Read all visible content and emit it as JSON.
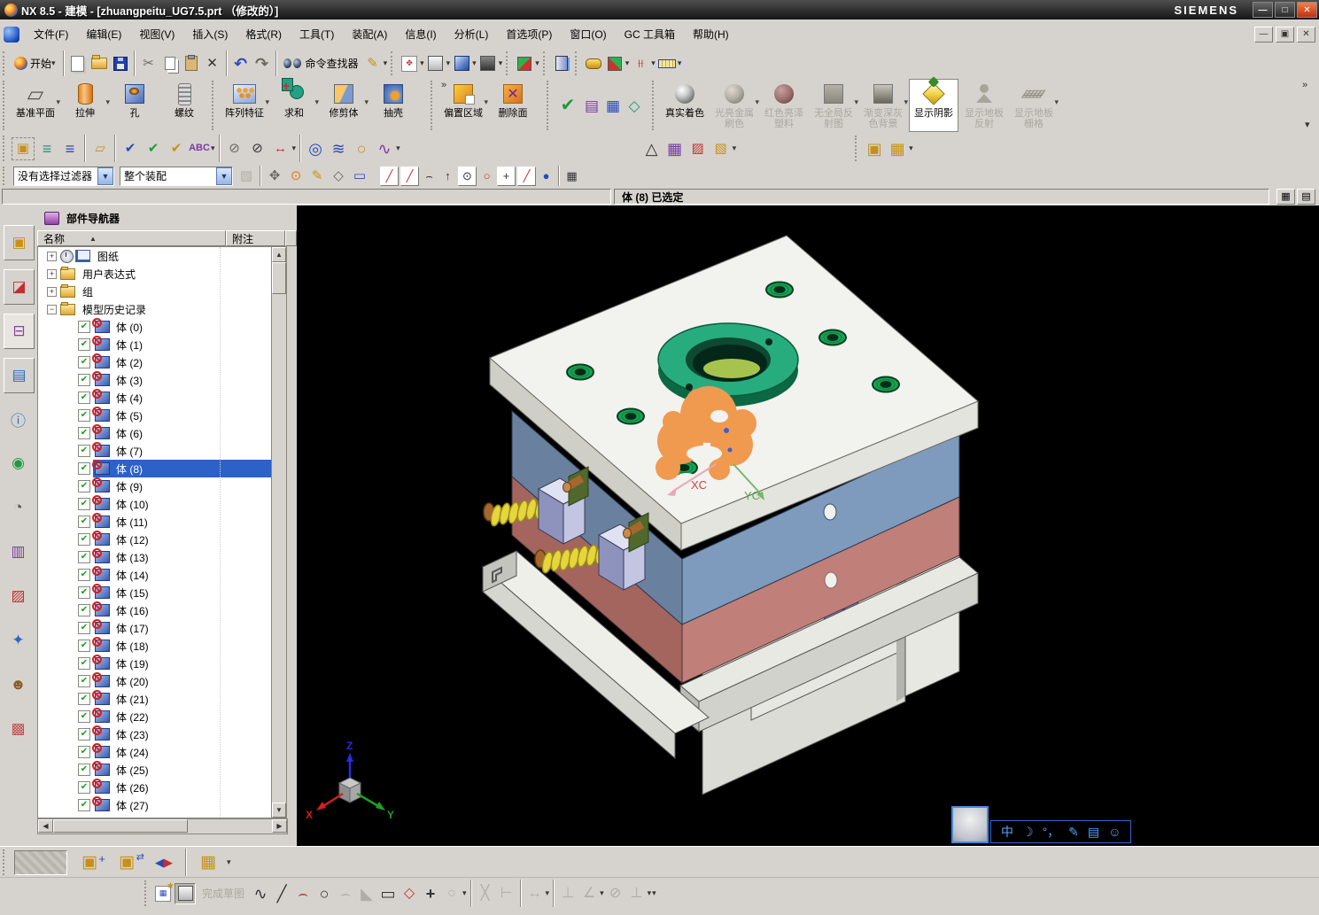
{
  "app": {
    "title": "NX 8.5 - 建模 - [zhuangpeitu_UG7.5.prt （修改的）]",
    "brand": "SIEMENS"
  },
  "menu_bar": {
    "items": [
      "文件(F)",
      "编辑(E)",
      "视图(V)",
      "插入(S)",
      "格式(R)",
      "工具(T)",
      "装配(A)",
      "信息(I)",
      "分析(L)",
      "首选项(P)",
      "窗口(O)",
      "GC 工具箱",
      "帮助(H)"
    ]
  },
  "standard_toolbar": {
    "start_label": "开始",
    "command_finder_label": "命令查找器"
  },
  "feature_toolbar": {
    "buttons": [
      "基准平面",
      "拉伸",
      "孔",
      "螺纹",
      "阵列特征",
      "求和",
      "修剪体",
      "抽壳",
      "偏置区域",
      "删除面"
    ],
    "render_buttons": [
      "真实着色",
      "光亮金属\n刷色",
      "红色亮泽\n塑料",
      "无全局反\n射图",
      "渐变深灰\n色背景",
      "显示阴影",
      "显示地板\n反射",
      "显示地板\n栅格"
    ]
  },
  "selection_bar": {
    "filter_value": "没有选择过滤器",
    "scope_value": "整个装配"
  },
  "status_bar": {
    "message": "体 (8) 已选定"
  },
  "navigator": {
    "title": "部件导航器",
    "columns": {
      "name": "名称",
      "note": "附注"
    },
    "folders": [
      {
        "label": "图纸"
      },
      {
        "label": "用户表达式"
      },
      {
        "label": "组"
      },
      {
        "label": "模型历史记录"
      }
    ],
    "bodies": [
      "体 (0)",
      "体 (1)",
      "体 (2)",
      "体 (3)",
      "体 (4)",
      "体 (5)",
      "体 (6)",
      "体 (7)",
      "体 (8)",
      "体 (9)",
      "体 (10)",
      "体 (11)",
      "体 (12)",
      "体 (13)",
      "体 (14)",
      "体 (15)",
      "体 (16)",
      "体 (17)",
      "体 (18)",
      "体 (19)",
      "体 (20)",
      "体 (21)",
      "体 (22)",
      "体 (23)",
      "体 (24)",
      "体 (25)",
      "体 (26)",
      "体 (27)"
    ],
    "selected_body_index": 8
  },
  "viewport": {
    "wcs_labels": {
      "x": "XC",
      "y": "YC"
    },
    "triad_labels": {
      "x": "X",
      "y": "Y",
      "z": "Z"
    },
    "model_colors": {
      "top_plate": "#f2f2ee",
      "top_plate_left": "#cfcfc8",
      "top_plate_right": "#e4e4de",
      "a_plate": "#7e9abc",
      "a_plate_left": "#69819e",
      "b_plate": "#c07f78",
      "b_plate_left": "#a4655f",
      "base_plate": "#e9e9e4",
      "ring_top": "#27ad7d",
      "ring_side": "#0b6843",
      "screw_green": "#17a455",
      "highlight_orange": "#f09a50",
      "spring_purple": "#8070cc",
      "spring_yellow": "#e6d53c",
      "slider_body": "#8e93bd",
      "lock_plate": "#50682c",
      "pin_brown": "#a5672e",
      "ejector_pink": "#d4a8b4"
    }
  },
  "ime_bar": {
    "lang_indicator": "中"
  },
  "bottom_toolbar": {
    "finish_sketch_label": "完成草图"
  },
  "icons": {
    "dropdown": "▾",
    "overflow": "»",
    "sort-asc": "▲",
    "expand": "+",
    "collapse": "−",
    "check": "✔",
    "minimize": "—",
    "maximize": "□",
    "restore": "▣",
    "close": "✕",
    "scissors": "✂",
    "undo": "↶",
    "redo": "↷",
    "delete-x": "✕",
    "snap-line": "╱",
    "snap-line2": "╱",
    "snap-arc": "⌢",
    "snap-vertex": "↑",
    "snap-center": "⊙",
    "snap-circle": "○",
    "snap-cross": "+",
    "snap-sphere": "●",
    "snap-grid": "▦",
    "triangle": "△",
    "grid": "▦",
    "layers": "≡",
    "note-tag": "▱",
    "orient-box": "▣",
    "check-mark": "✔",
    "table": "▤",
    "view-cube": "◇",
    "coil": "◎",
    "spring": "≋",
    "ring": "○",
    "wave": "∿",
    "profile": "∿",
    "line": "╱",
    "arc": "⌢",
    "circle": "○",
    "fillet": "⌢",
    "chamfer": "◣",
    "rectangle": "▭",
    "polygon": "◇",
    "point": "+",
    "offset": "○",
    "trim": "╳",
    "extend": "⊢",
    "dimension": "↔",
    "perpendicular": "⊥",
    "angle": "∠",
    "no-symbol": "⊘",
    "moon": "☽",
    "punct": "°，",
    "pencil": "✎",
    "keyboard": "▤",
    "smiley": "☺",
    "folder-red": "▨",
    "folder-circles": "▧",
    "lock-gold": "▣",
    "cubes-gold": "▦",
    "move": "✥",
    "constrain-lr": "◀▶",
    "star": "★"
  }
}
